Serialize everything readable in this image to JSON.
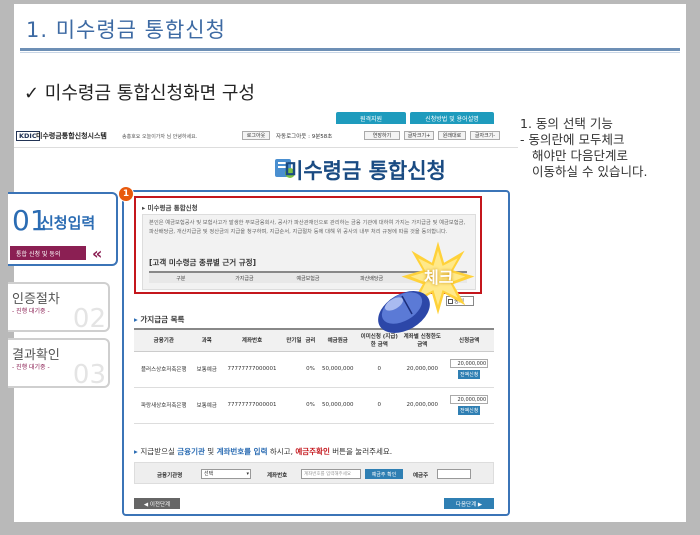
{
  "slide": {
    "title": "1. 미수령금 통합신청",
    "subtitle": "✓ 미수령금 통합신청화면 구성"
  },
  "annotation": {
    "line1": "1. 동의 선택 기능",
    "line2": "- 동의란에 모두체크",
    "line3": "해야만 다음단계로",
    "line4": "이동하실 수 있습니다."
  },
  "site": {
    "topnav": [
      "원격지원",
      "신청방법 및 용어설명"
    ],
    "logo": "KDIC",
    "name": "미수령금통합신청시스템",
    "welcome": "송홍호요 오늘이가자 님 안녕하세요.",
    "logout": "로그아웃",
    "auto_logout": "자동로그아웃 : 9분58초",
    "buttons": [
      "연장하기",
      "글자크기+",
      "원래대로",
      "글자크기-"
    ],
    "page_title": "미수령금 통합신청"
  },
  "steps": [
    {
      "num": "01",
      "label": "신청입력",
      "sub": "통합 신청 및 동의"
    },
    {
      "label": "인증절차",
      "sub": "- 진행 대기중 -",
      "num": "02"
    },
    {
      "label": "결과확인",
      "sub": "- 진행 대기중 -",
      "num": "03"
    }
  ],
  "consent": {
    "badge": "1",
    "heading": "미수령금 통합신청",
    "text": "본인은 예금보험공사 및 보험사고가 발생한 부보금융회사, 공사가 파산관재인으로 관리하는 금융 기관에 대하여 가지는 가지급금 및 예금보험금, 파산배당금, 개산지급금 및 정산금의 지급을 청구하며, 지급순서, 지급절차 등에 대해 위 공사의 내부 처리 규정에 따를 것을 동의합니다.",
    "group_title": "[고객 미수령금 종류별 근거 규정]",
    "columns": [
      "구분",
      "가지급금",
      "예금보험금",
      "파산배당금",
      "개산지급금"
    ],
    "agree_label": "동의",
    "check_label": "체크"
  },
  "accounts": {
    "title": "가지급금 목록",
    "headers": [
      "금융기관",
      "과목",
      "계좌번호",
      "만기일",
      "금리",
      "예금원금",
      "이미신청 (지급)한 금액",
      "계좌별 신청한도 금액",
      "신청금액"
    ],
    "rows": [
      {
        "bank": "플러스상호저축은행",
        "type": "보통예금",
        "account": "77777777000001",
        "maturity": "",
        "rate": "0%",
        "principal": "50,000,000",
        "paid": "0",
        "limit": "20,000,000",
        "amount": "20,000,000",
        "btn": "전액신청"
      },
      {
        "bank": "파랑새상호저축은행",
        "type": "보통예금",
        "account": "77777777000001",
        "maturity": "",
        "rate": "0%",
        "principal": "50,000,000",
        "paid": "0",
        "limit": "20,000,000",
        "amount": "20,000,000",
        "btn": "전액신청"
      }
    ]
  },
  "instruction": {
    "pre": "지급받으실 ",
    "hl1": "금융기관",
    "mid1": " 및 ",
    "hl2": "계좌번호를 입력",
    "mid2": " 하시고, ",
    "hl3": "예금주확인",
    "post": " 버튼을 눌러주세요."
  },
  "search": {
    "bank_label": "금융기관명",
    "bank_value": "선택",
    "account_label": "계좌번호",
    "account_placeholder": "계좌번호를 입력해주세요",
    "confirm_btn": "예금주 확인",
    "holder_label": "예금주"
  },
  "nav": {
    "prev": "◀ 이전단계",
    "next": "다음단계 ▶"
  }
}
